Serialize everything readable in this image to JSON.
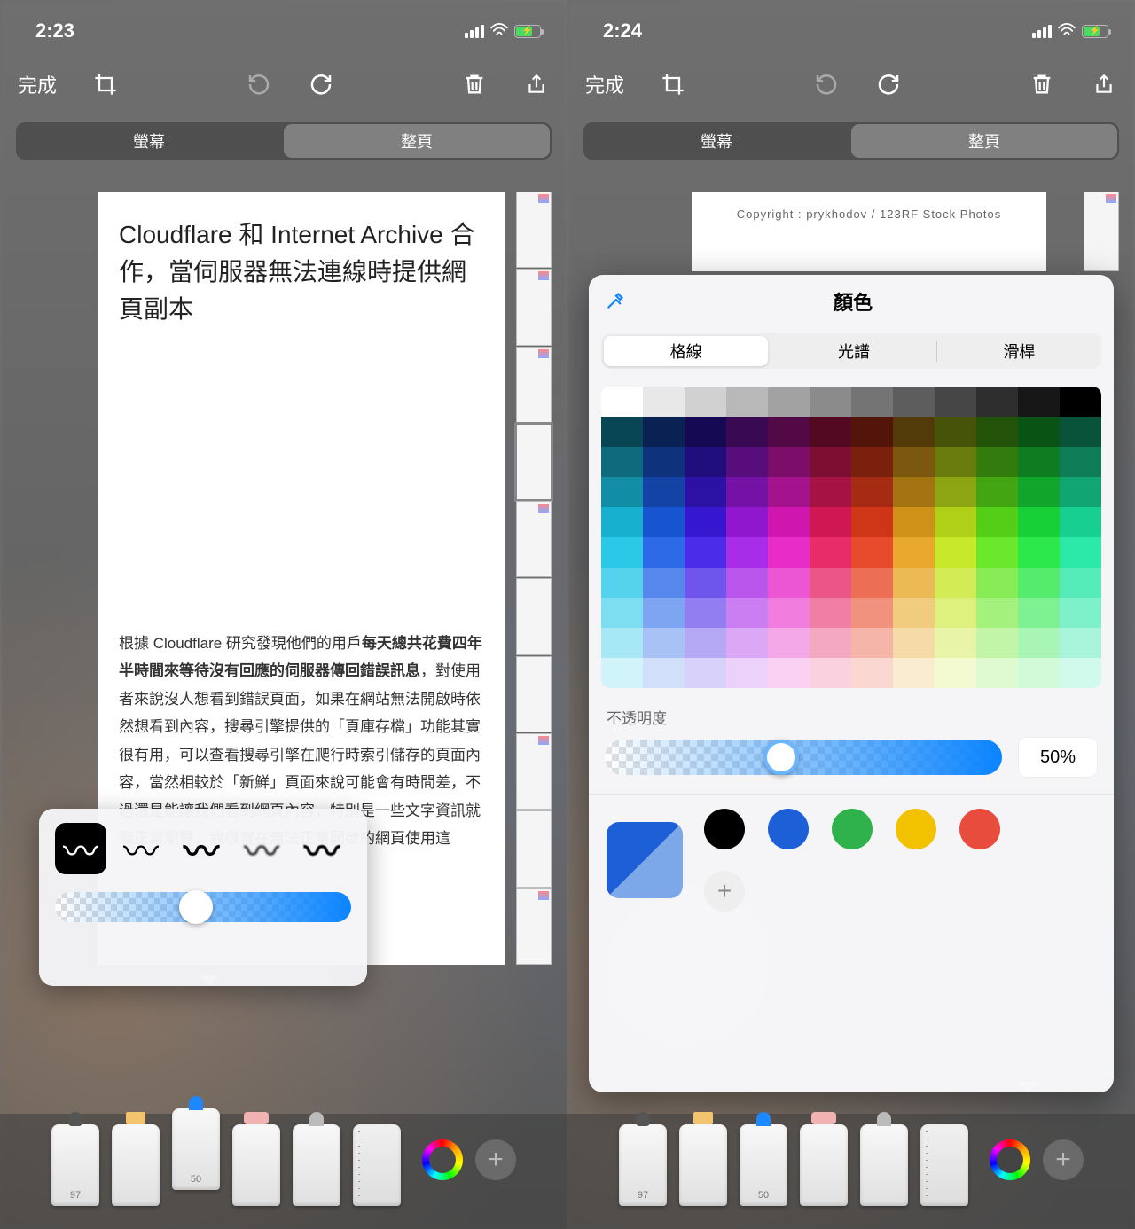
{
  "left": {
    "time": "2:23",
    "done": "完成",
    "tabs": {
      "screen": "螢幕",
      "full": "整頁"
    },
    "doc_title": "Cloudflare 和 Internet Archive 合作，當伺服器無法連線時提供網頁副本",
    "doc_body_prefix": "根據 Cloudflare 研究發現他們的用戶",
    "doc_body_bold": "每天總共花費四年半時間來等待沒有回應的伺服器傳回錯誤訊息",
    "doc_body_rest": "，對使用者來說沒人想看到錯誤頁面，如果在網站無法開啟時依然想看到內容，搜尋引擎提供的「頁庫存檔」功能其實很有用，可以查看搜尋引擎在爬行時索引儲存的頁面內容，當然相較於「新鮮」頁面來說可能會有時間差，不過還是能讓我們看到網頁內容，特別是一些文字資訊就能正常瀏覽，我很常在無法正常開啟的網頁使用這",
    "tool_labels": {
      "pen": "97",
      "pencil": "50"
    }
  },
  "right": {
    "time": "2:24",
    "done": "完成",
    "tabs": {
      "screen": "螢幕",
      "full": "整頁"
    },
    "caption": "Copyright : prykhodov / 123RF Stock Photos",
    "picker": {
      "title": "顏色",
      "seg": {
        "grid": "格線",
        "spectrum": "光譜",
        "sliders": "滑桿"
      },
      "opacity_label": "不透明度",
      "opacity_value": "50%",
      "swatches": [
        "#000000",
        "#1d5fd6",
        "#2fb24c",
        "#f2c200",
        "#e84c3d"
      ]
    },
    "tool_labels": {
      "pen": "97",
      "pencil": "50"
    }
  }
}
